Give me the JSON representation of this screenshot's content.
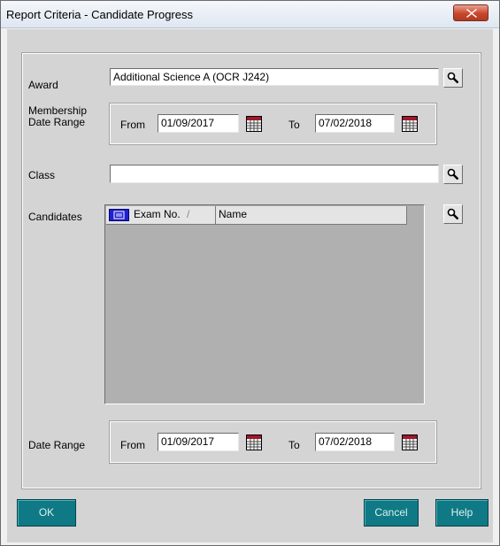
{
  "window": {
    "title": "Report Criteria - Candidate Progress"
  },
  "award": {
    "label": "Award",
    "value": "Additional Science A (OCR J242)"
  },
  "membership": {
    "label_line1": "Membership",
    "label_line2": "Date Range",
    "from_label": "From",
    "from_value": "01/09/2017",
    "to_label": "To",
    "to_value": "07/02/2018"
  },
  "class_field": {
    "label": "Class",
    "value": ""
  },
  "candidates": {
    "label": "Candidates",
    "columns": [
      "Exam No.",
      "Name"
    ],
    "sort_indicator": "/"
  },
  "date_range": {
    "label": "Date Range",
    "from_label": "From",
    "from_value": "01/09/2017",
    "to_label": "To",
    "to_value": "07/02/2018"
  },
  "buttons": {
    "ok": "OK",
    "cancel": "Cancel",
    "help": "Help"
  },
  "colors": {
    "button_bg": "#0f7a85",
    "close_red": "#c8472c",
    "grid_bg": "#b0b0b0"
  },
  "icons": {
    "close": "close-icon",
    "search": "magnifier-icon",
    "calendar": "calendar-icon",
    "grid_selector": "grid-selector-icon"
  }
}
